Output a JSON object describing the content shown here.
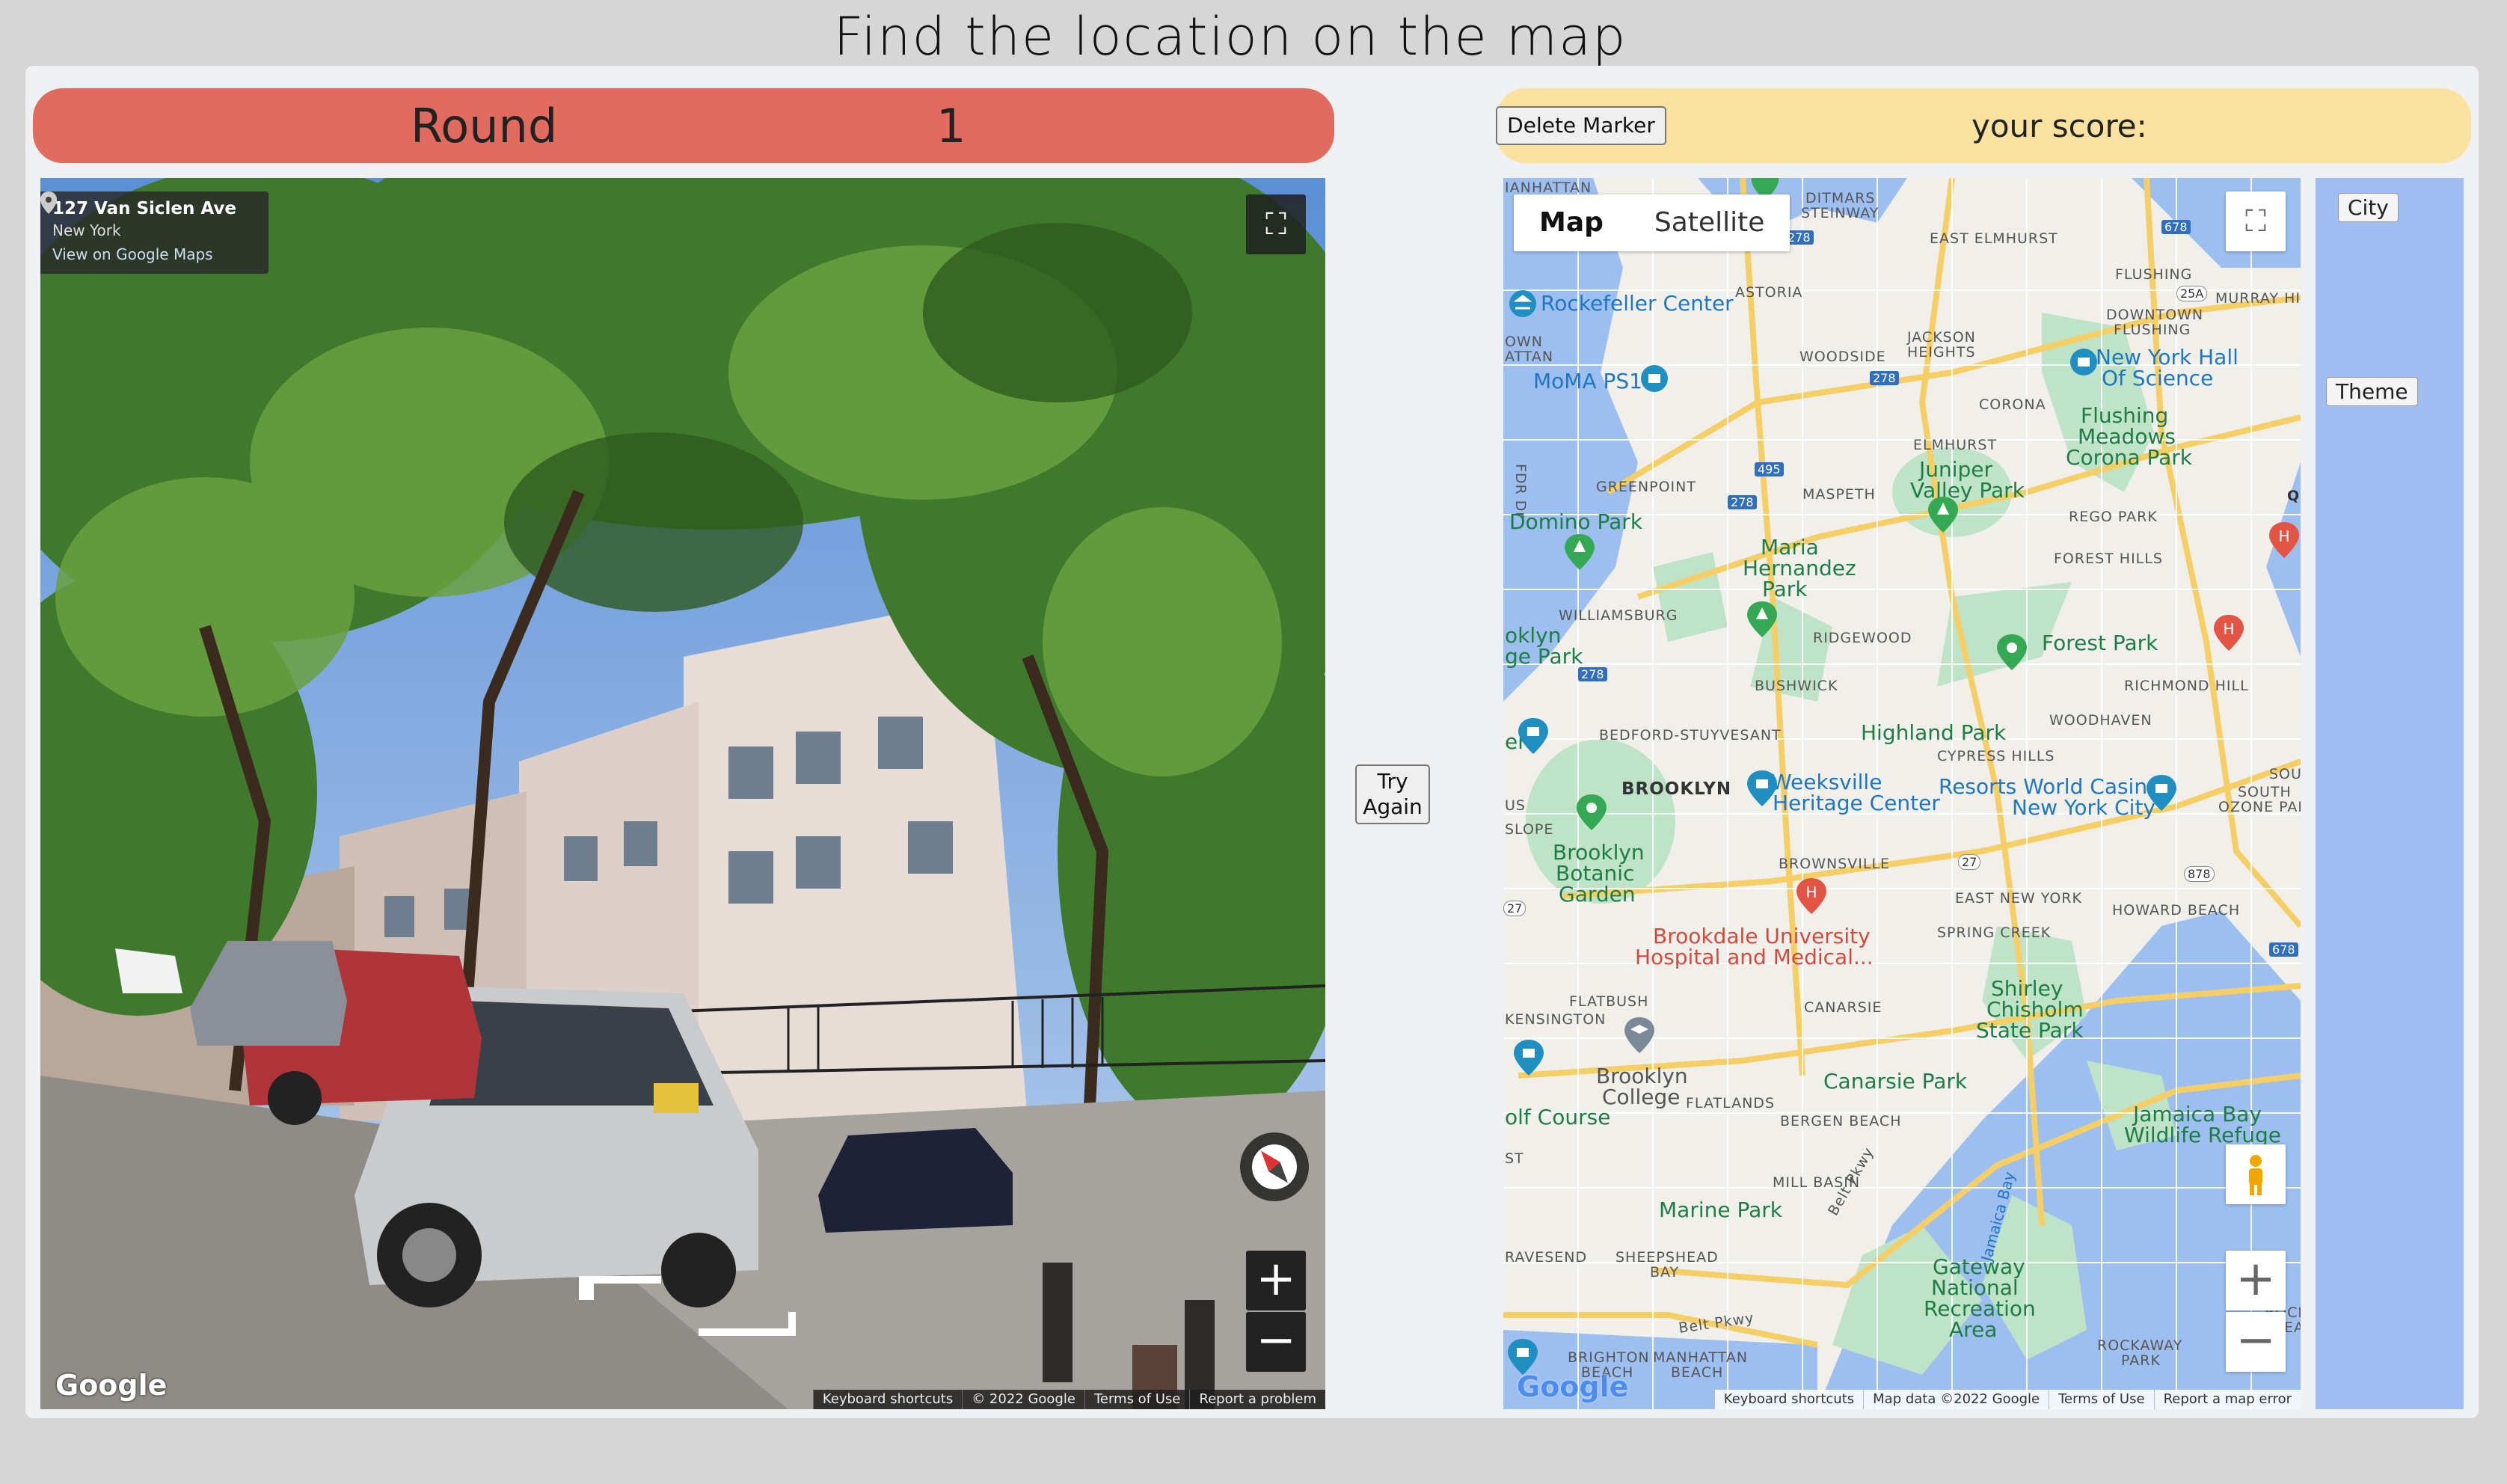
{
  "page": {
    "title": "Find the location on the map"
  },
  "round": {
    "label": "Round",
    "number": "1"
  },
  "score": {
    "label": "your score:"
  },
  "buttons": {
    "delete_marker": "Delete Marker",
    "try_again_line1": "Try",
    "try_again_line2": "Again"
  },
  "streetview": {
    "address": "127 Van Siclen Ave",
    "city": "New York",
    "link": "View on Google Maps",
    "google": "Google",
    "attribution": [
      "Keyboard shortcuts",
      "© 2022 Google",
      "Terms of Use",
      "Report a problem"
    ],
    "icons": [
      "pin-icon",
      "fullscreen-icon",
      "compass-icon",
      "zoom-in-icon",
      "zoom-out-icon"
    ]
  },
  "map": {
    "type_buttons": {
      "map": "Map",
      "satellite": "Satellite"
    },
    "selected": "Map",
    "google": "Google",
    "attribution": [
      "Keyboard shortcuts",
      "Map data ©2022 Google",
      "Terms of Use",
      "Report a map error"
    ],
    "neighborhoods": {
      "manhattan": "IANHATTAN",
      "ditmars": "DITMARS",
      "steinway": "STEINWAY",
      "east_elmhurst": "EAST ELMHURST",
      "flushing": "FLUSHING",
      "downtown": "DOWNTOWN",
      "downtown2": "FLUSHING",
      "murray": "MURRAY HI",
      "astoria": "ASTORIA",
      "jackson": "JACKSON",
      "heights": "HEIGHTS",
      "woodside": "WOODSIDE",
      "corona": "CORONA",
      "own": "OWN",
      "attan": "ATTAN",
      "greenpoint": "GREENPOINT",
      "maspeth": "MASPETH",
      "elmhurst": "ELMHURST",
      "rego": "REGO PARK",
      "forest_hills": "FOREST HILLS",
      "williamsburg": "WILLIAMSBURG",
      "ridgewood": "RIDGEWOOD",
      "bushwick": "BUSHWICK",
      "richmond": "RICHMOND HILL",
      "woodhaven": "WOODHAVEN",
      "bedford": "BEDFORD-STUYVESANT",
      "cypress": "CYPRESS HILLS",
      "brooklyn": "BROOKLYN",
      "slope": "SLOPE",
      "us": "US",
      "south": "SOUTH",
      "ozone": "OZONE PARK",
      "sou": "SOU",
      "brownsville": "BROWNSVILLE",
      "east_ny": "EAST NEW YORK",
      "spring": "SPRING CREEK",
      "howard": "HOWARD BEACH",
      "flatbush": "FLATBUSH",
      "kensington": "KENSINGTON",
      "canarsie": "CANARSIE",
      "flatlands": "FLATLANDS",
      "bergen": "BERGEN BEACH",
      "st": "ST",
      "mill": "MILL BASIN",
      "gravesend": "RAVESEND",
      "sheepshead": "SHEEPSHEAD",
      "bay": "BAY",
      "brighton": "BRIGHTON",
      "beach": "BEACH",
      "manhattan_b": "MANHATTAN",
      "beach2": "BEACH",
      "rockaway": "ROCKAWAY",
      "park": "PARK",
      "rock": "ROCK",
      "bea": "BEA",
      "q": "Q"
    },
    "places": {
      "rockefeller": "Rockefeller Center",
      "moma": "MoMA PS1",
      "nyhall1": "New York Hall",
      "nyhall2": "Of Science",
      "fmcp1": "Flushing",
      "fmcp2": "Meadows",
      "fmcp3": "Corona Park",
      "juniper1": "Juniper",
      "juniper2": "Valley Park",
      "domino": "Domino Park",
      "maria1": "Maria",
      "maria2": "Hernandez",
      "maria3": "Park",
      "oklyn": "oklyn",
      "gepark": "ge Park",
      "forest_park": "Forest Park",
      "highland": "Highland Park",
      "weeks1": "Weeksville",
      "weeks2": "Heritage Center",
      "resorts1": "Resorts World Casino",
      "resorts2": "New York City",
      "er": "er",
      "bbg1": "Brooklyn",
      "bbg2": "Botanic",
      "bbg3": "Garden",
      "brookdale1": "Brookdale University",
      "brookdale2": "Hospital and Medical...",
      "shirley1": "Shirley",
      "shirley2": "Chisholm",
      "shirley3": "State Park",
      "bkcollege1": "Brooklyn",
      "bkcollege2": "College",
      "canarsie_park": "Canarsie Park",
      "olf": "olf Course",
      "jamaica1": "Jamaica Bay",
      "jamaica2": "Wildlife Refuge",
      "marine": "Marine Park",
      "gateway1": "Gateway",
      "gateway2": "National",
      "gateway3": "Recreation",
      "gateway4": "Area",
      "jamaica_bay": "Jamaica Bay",
      "belt1": "Belt Pkwy",
      "belt2": "Belt Pkwy",
      "fdr": "FDR Dr"
    },
    "shields": [
      "278",
      "678",
      "25A",
      "278",
      "495",
      "278",
      "278",
      "27",
      "878",
      "678",
      "27"
    ]
  },
  "sidebar": {
    "city": "City",
    "theme": "Theme"
  },
  "colors": {
    "round_bar": "#e06b5e",
    "score_bar": "#f9e2a0",
    "water": "#9dbff0",
    "park": "#bfe3c6",
    "strip": "#9fbdf0"
  }
}
